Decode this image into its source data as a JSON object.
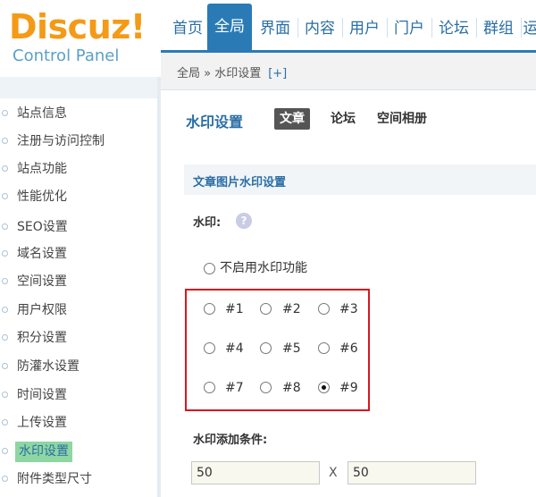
{
  "logo": {
    "main": "Discuz!",
    "sub": "Control Panel"
  },
  "top_nav": [
    "首页",
    "全局",
    "界面",
    "内容",
    "用户",
    "门户",
    "论坛",
    "群组",
    "运"
  ],
  "breadcrumb": {
    "path": "全局 » 水印设置",
    "add": "[+]"
  },
  "sidebar": {
    "items": [
      "站点信息",
      "注册与访问控制",
      "站点功能",
      "性能优化",
      "SEO设置",
      "域名设置",
      "空间设置",
      "用户权限",
      "积分设置",
      "防灌水设置",
      "时间设置",
      "上传设置",
      "水印设置",
      "附件类型尺寸"
    ],
    "active_index": 12
  },
  "main": {
    "title": "水印设置",
    "tabs": [
      "文章",
      "论坛",
      "空间相册"
    ],
    "active_tab": 0,
    "section_title": "文章图片水印设置",
    "watermark_label": "水印:",
    "help_icon": "?",
    "disable_option": "不启用水印功能",
    "positions": [
      "#1",
      "#2",
      "#3",
      "#4",
      "#5",
      "#6",
      "#7",
      "#8",
      "#9"
    ],
    "selected_position": "#9",
    "condition_label": "水印添加条件:",
    "width_value": "50",
    "x_label": "X",
    "height_value": "50"
  },
  "colors": {
    "brand_orange": "#f49a16",
    "nav_blue": "#2a7bb5",
    "link_blue": "#2a6ea5",
    "highlight_red": "#d7171f",
    "active_green": "#8ed6a2"
  }
}
